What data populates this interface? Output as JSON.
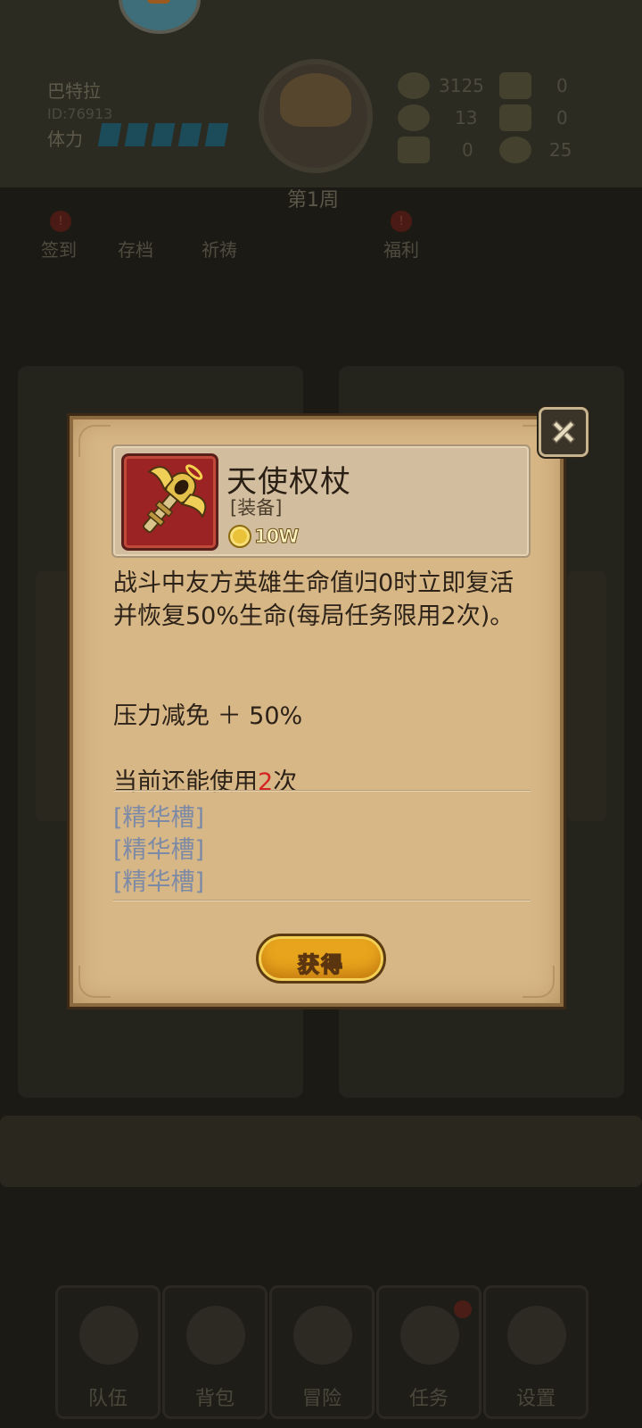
{
  "background": {
    "player": {
      "name": "巴特拉",
      "id": "ID:76913",
      "stamina_label": "体力"
    },
    "week": "第1周",
    "resources": [
      {
        "icon": "gold-coin-icon",
        "value": "3125"
      },
      {
        "icon": "scroll-icon",
        "value": "0"
      },
      {
        "icon": "gem-icon",
        "value": "13"
      },
      {
        "icon": "card-icon",
        "value": "0"
      },
      {
        "icon": "ticket-icon",
        "value": "0"
      },
      {
        "icon": "crystal-icon",
        "value": "25"
      }
    ],
    "menu": [
      {
        "label": "签到",
        "badge": "!"
      },
      {
        "label": "存档",
        "badge": ""
      },
      {
        "label": "祈祷",
        "badge": ""
      },
      {
        "label": "福利",
        "badge": "!"
      }
    ],
    "nav": [
      {
        "label": "队伍",
        "icon": "team-icon"
      },
      {
        "label": "背包",
        "icon": "bag-icon"
      },
      {
        "label": "冒险",
        "icon": "crossed-swords-icon"
      },
      {
        "label": "任务",
        "icon": "quest-icon"
      },
      {
        "label": "设置",
        "icon": "gear-icon"
      }
    ]
  },
  "modal": {
    "item_name": "天使权杖",
    "item_type": "[装备]",
    "price": "10W",
    "description": "战斗中友方英雄生命值归0时立即复活并恢复50%生命(每局任务限用2次)。",
    "stat": "压力减免 ＋ 50%",
    "uses_prefix": "当前还能使用",
    "uses_count": "2",
    "uses_suffix": "次",
    "slots": [
      "[精华槽]",
      "[精华槽]",
      "[精华槽]"
    ],
    "obtain_button": "获得"
  },
  "colors": {
    "paper": "#d8b787",
    "uses_highlight": "#d42323",
    "slot_text": "#7d8aa6",
    "button": "#e7a51d"
  }
}
